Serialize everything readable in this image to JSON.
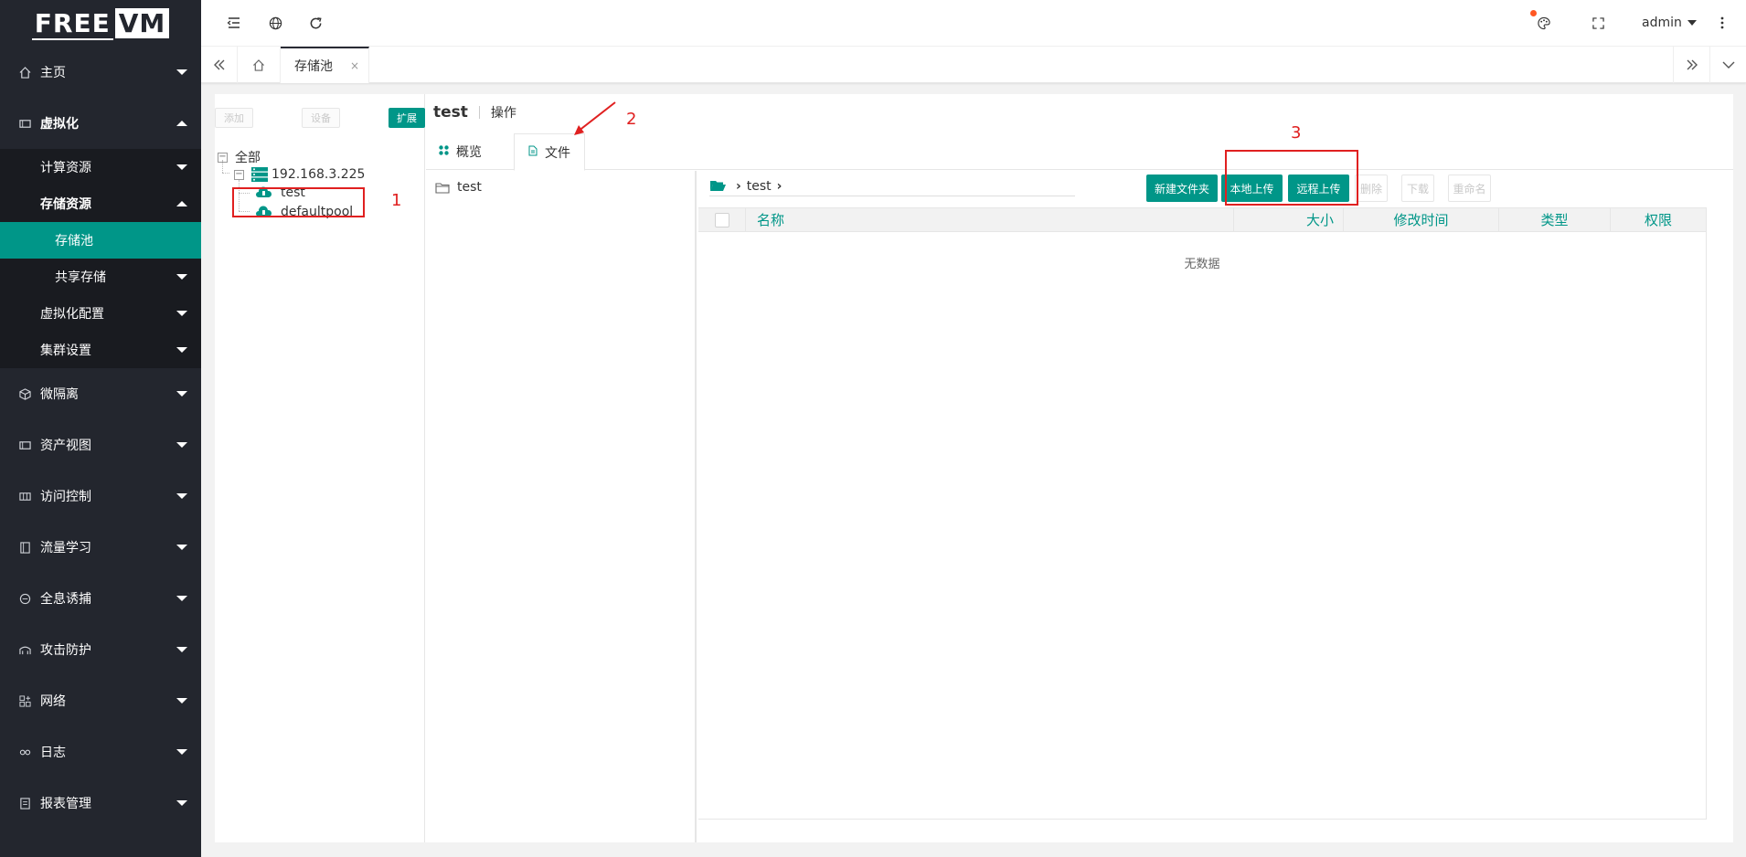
{
  "brand": {
    "free": "FREE",
    "vm": "VM"
  },
  "sidebar": {
    "items": [
      {
        "label": "主页",
        "icon": "home-icon"
      },
      {
        "label": "虚拟化",
        "icon": "server-icon"
      },
      {
        "label": "微隔离",
        "icon": "cube-icon"
      },
      {
        "label": "资产视图",
        "icon": "server-icon"
      },
      {
        "label": "访问控制",
        "icon": "grid-icon"
      },
      {
        "label": "流量学习",
        "icon": "book-icon"
      },
      {
        "label": "全息诱捕",
        "icon": "target-icon"
      },
      {
        "label": "攻击防护",
        "icon": "shield-icon"
      },
      {
        "label": "网络",
        "icon": "network-icon"
      },
      {
        "label": "日志",
        "icon": "link-icon"
      },
      {
        "label": "报表管理",
        "icon": "report-icon"
      }
    ],
    "virtualization_sub": {
      "compute": "计算资源",
      "storage": "存储资源",
      "storage_pool": "存储池",
      "shared_storage": "共享存储",
      "virt_config": "虚拟化配置",
      "cluster_settings": "集群设置"
    }
  },
  "header": {
    "user": "admin"
  },
  "tabsbar": {
    "active_tab": "存储池",
    "close": "×"
  },
  "tree": {
    "buttons": {
      "add": "添加",
      "device": "设备",
      "expand": "扩展"
    },
    "root": "全部",
    "host": "192.168.3.225",
    "pools": [
      "test",
      "defaultpool"
    ]
  },
  "content": {
    "title": "test",
    "ops": "操作",
    "tabs": {
      "overview": "概览",
      "files": "文件"
    },
    "folder": "test",
    "path": [
      "test"
    ],
    "actions": {
      "new_folder": "新建文件夹",
      "local_upload": "本地上传",
      "remote_upload": "远程上传",
      "delete": "删除",
      "download": "下载",
      "rename": "重命名"
    },
    "table": {
      "columns": [
        "名称",
        "大小",
        "修改时间",
        "类型",
        "权限"
      ],
      "empty": "无数据"
    }
  },
  "annotations": {
    "n1": "1",
    "n2": "2",
    "n3": "3"
  },
  "colors": {
    "accent": "#009688",
    "sidebar": "#23262e",
    "annotation": "#e02020"
  }
}
